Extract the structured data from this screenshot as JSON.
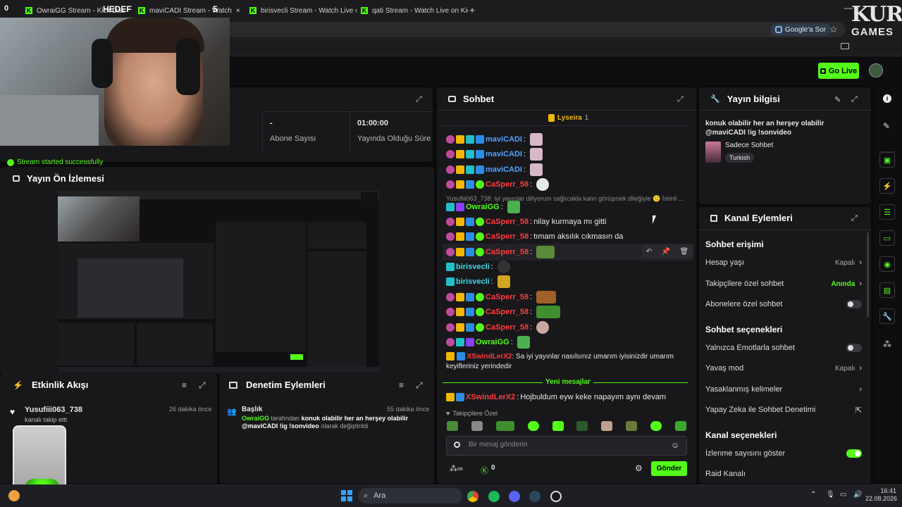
{
  "browser": {
    "tab_count": "0",
    "tabs": [
      {
        "label": "OwraiGG Stream - Kick Das",
        "close": "×"
      },
      {
        "label": "maviCADI Stream - Watch",
        "close": "×"
      },
      {
        "label": "birisvecli Stream - Watch Live o",
        "close": "×"
      },
      {
        "label": "qati Stream - Watch Live on Kic",
        "close": "×"
      }
    ],
    "new_tab": "+",
    "overlay_hedef": "HEDEF",
    "overlay_five": "5",
    "google_sor": "Google'a Sor",
    "minimize": "—"
  },
  "branding": {
    "line1": "KURA",
    "line2": "GAMES"
  },
  "header": {
    "go_live": "Go Live"
  },
  "stats": {
    "sub_value": "-",
    "sub_label": "Abone Sayısı",
    "time_value": "01:00:00",
    "time_label": "Yayında Olduğu Süre",
    "stream_started": "Stream started successfully"
  },
  "preview": {
    "title": "Yayın Ön İzlemesi"
  },
  "activity": {
    "title": "Etkinlik Akışı",
    "user": "Yusufiii063_738",
    "time": "26 dakika önce",
    "action": "kanalı takip etti"
  },
  "moderation": {
    "title": "Denetim Eylemleri",
    "item_title": "Başlık",
    "time": "55 dakika önce",
    "actor": "OwraiGG",
    "mid": "tarafından",
    "value": "konuk olabilir her an herşey olabilir @maviCADI !ig !sonvideo",
    "suffix": "olarak değiştirildi"
  },
  "chat": {
    "title": "Sohbet",
    "pinned_user": "Lyseira",
    "pinned_count": "1",
    "reply_text": "Yusufiii063_738: iyi yayınlar diliyorum sağlıcakla kalın görüşmek dileğiyle 🙂 İsimli ...",
    "messages": [
      {
        "user": "maviCADI",
        "text": ""
      },
      {
        "user": "maviCADI",
        "text": ""
      },
      {
        "user": "maviCADI",
        "text": ""
      },
      {
        "user": "CaSperr_58",
        "text": ""
      },
      {
        "user": "OwraiGG",
        "text": ""
      },
      {
        "user": "CaSperr_58",
        "text": "nilay kurmaya mı gitti"
      },
      {
        "user": "CaSperr_58",
        "text": "tımam aksılık cıkmasın da"
      },
      {
        "user": "CaSperr_58",
        "text": ""
      },
      {
        "user": "birisvecli",
        "text": ""
      },
      {
        "user": "birisvecli",
        "text": ""
      },
      {
        "user": "CaSperr_58",
        "text": ""
      },
      {
        "user": "CaSperr_58",
        "text": ""
      },
      {
        "user": "CaSperr_58",
        "text": ""
      },
      {
        "user": "OwraiGG",
        "text": ""
      },
      {
        "user": "XSwindLerX2",
        "text": "Sa iyi yayınlar nasılsınız umarım iyisinizdir umarım keyifleriniz yerindedir"
      },
      {
        "user": "XSwindLerX2",
        "text": "Hojbuldum eyw keke napayım aynı devam"
      }
    ],
    "new_messages": "Yeni mesajlar",
    "followers_only": "Takipçilere Özel",
    "placeholder": "Bir mesaj gönderin",
    "count": "0",
    "send": "Gönder"
  },
  "stream_info": {
    "title": "Yayın bilgisi",
    "stream_title": "konuk olabilir her an herşey olabilir @maviCADI !ig !sonvideo",
    "category": "Sadece Sohbet",
    "language": "Turkish"
  },
  "channel_actions": {
    "title": "Kanal Eylemleri",
    "chat_access": "Sohbet erişimi",
    "account_age": "Hesap yaşı",
    "account_age_val": "Kapalı",
    "followers_chat": "Takipçilere özel sohbet",
    "followers_chat_val": "Anında",
    "subs_chat": "Abonelere özel sohbet",
    "chat_options": "Sohbet seçenekleri",
    "emote_only": "Yalnızca Emotlarla sohbet",
    "slow_mode": "Yavaş mod",
    "slow_mode_val": "Kapalı",
    "banned_words": "Yasaklanmış kelimeler",
    "ai_moderation": "Yapay Zeka ile Sohbet Denetimi",
    "channel_options": "Kanal seçenekleri",
    "show_viewers": "İzlenme sayısını göster",
    "raid_channel": "Raid Kanalı"
  },
  "taskbar": {
    "search": "Ara",
    "time": "16:41",
    "date": "22.08.2026"
  },
  "colors": {
    "accent": "#53fc18",
    "panel": "#18181b",
    "bg": "#0b0b0c"
  }
}
